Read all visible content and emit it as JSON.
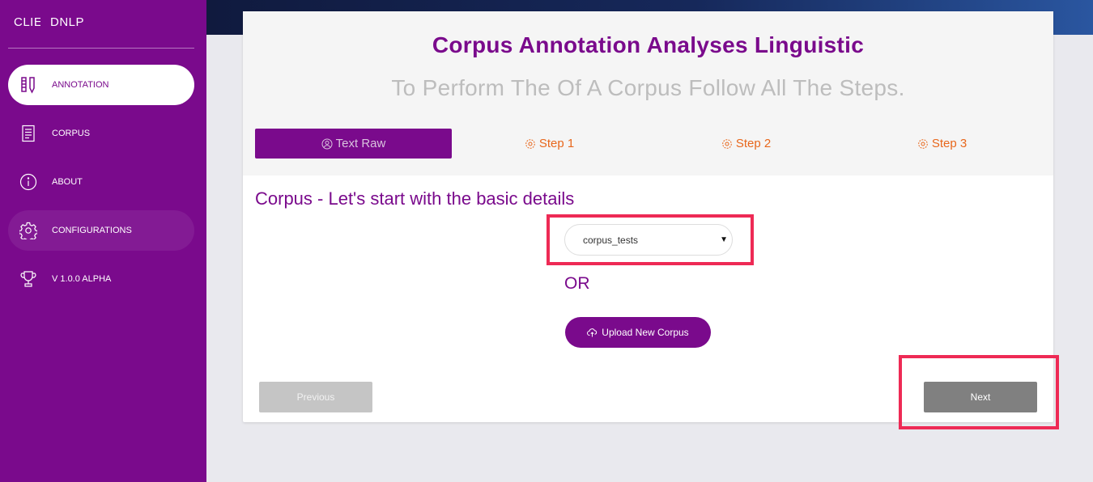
{
  "brand": {
    "part1": "CLIENT",
    "part2": "DNLP"
  },
  "sidebar": {
    "items": [
      {
        "label": "ANNOTATION",
        "icon": "annotation-icon",
        "state": "active"
      },
      {
        "label": "CORPUS",
        "icon": "document-icon",
        "state": "normal"
      },
      {
        "label": "ABOUT",
        "icon": "info-icon",
        "state": "normal"
      },
      {
        "label": "CONFIGURATIONS",
        "icon": "gear-icon",
        "state": "hover"
      },
      {
        "label": "V 1.0.0 ALPHA",
        "icon": "trophy-icon",
        "state": "normal"
      }
    ]
  },
  "header": {
    "title": "Corpus Annotation Analyses Linguistic",
    "subtitle": "To Perform The Of A Corpus Follow All The Steps."
  },
  "steps": [
    {
      "label": "Text Raw",
      "icon": "face-icon",
      "active": true
    },
    {
      "label": "Step 1",
      "icon": "gear-icon",
      "active": false
    },
    {
      "label": "Step 2",
      "icon": "gear-icon",
      "active": false
    },
    {
      "label": "Step 3",
      "icon": "gear-icon",
      "active": false
    }
  ],
  "form": {
    "section_title": "Corpus - Let's start with the basic details",
    "corpus_select_value": "corpus_tests",
    "or_text": "OR",
    "upload_label": "Upload New Corpus"
  },
  "footer": {
    "previous_label": "Previous",
    "next_label": "Next"
  },
  "colors": {
    "brand_purple": "#7a0a8c",
    "step_orange": "#e8671c",
    "highlight_red": "#ee2a55"
  }
}
